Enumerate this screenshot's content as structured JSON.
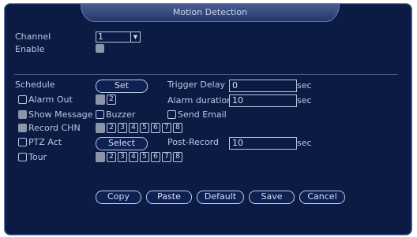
{
  "window": {
    "title": "Motion Detection"
  },
  "channel": {
    "label": "Channel",
    "value": "1"
  },
  "enable": {
    "label": "Enable"
  },
  "schedule": {
    "label": "Schedule",
    "button": "Set"
  },
  "trigger_delay": {
    "label": "Trigger Delay",
    "value": "0",
    "unit": "sec"
  },
  "alarm_out": {
    "label": "Alarm Out",
    "channels": [
      "1",
      "2"
    ]
  },
  "alarm_duration": {
    "label": "Alarm duration",
    "value": "10",
    "unit": "sec"
  },
  "show_message": {
    "label": "Show Message"
  },
  "buzzer": {
    "label": "Buzzer"
  },
  "send_email": {
    "label": "Send Email"
  },
  "record_chn": {
    "label": "Record CHN",
    "channels": [
      "1",
      "2",
      "3",
      "4",
      "5",
      "6",
      "7",
      "8"
    ]
  },
  "ptz_act": {
    "label": "PTZ Act",
    "button": "Select"
  },
  "post_record": {
    "label": "Post-Record",
    "value": "10",
    "unit": "sec"
  },
  "tour": {
    "label": "Tour",
    "channels": [
      "1",
      "2",
      "3",
      "4",
      "5",
      "6",
      "7",
      "8"
    ]
  },
  "actions": {
    "copy": "Copy",
    "paste": "Paste",
    "default": "Default",
    "save": "Save",
    "cancel": "Cancel"
  }
}
